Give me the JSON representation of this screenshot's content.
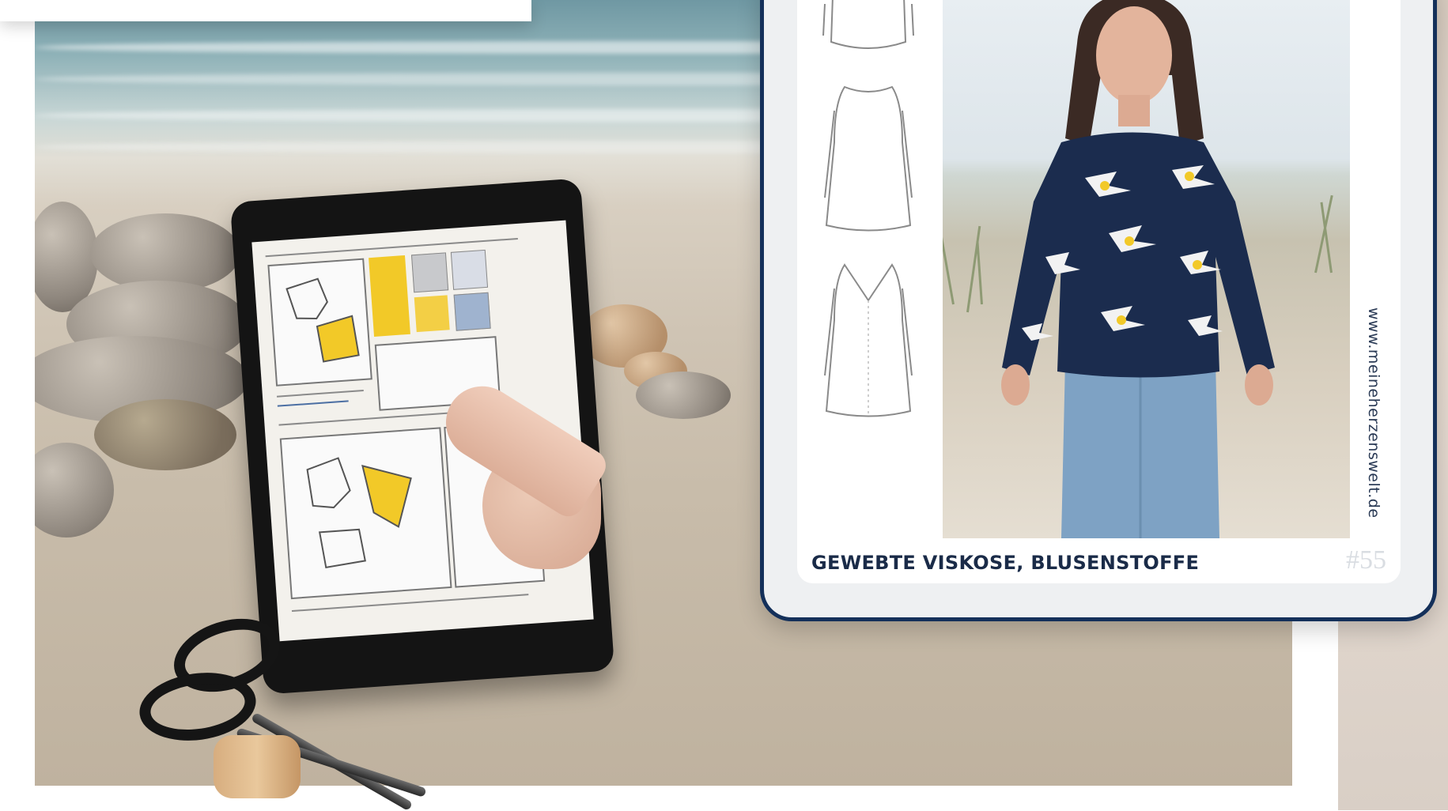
{
  "card": {
    "fabric_label": "GEWEBTE VISKOSE, BLUSENSTOFFE",
    "page_number": "#55",
    "website": "www.meineherzenswelt.de"
  },
  "colors": {
    "card_border": "#14305a",
    "label_text": "#1a2b48",
    "pattern_yellow": "#f2c928",
    "blouse_navy": "#1b2c4e"
  },
  "icons": [
    "scissors-icon"
  ]
}
